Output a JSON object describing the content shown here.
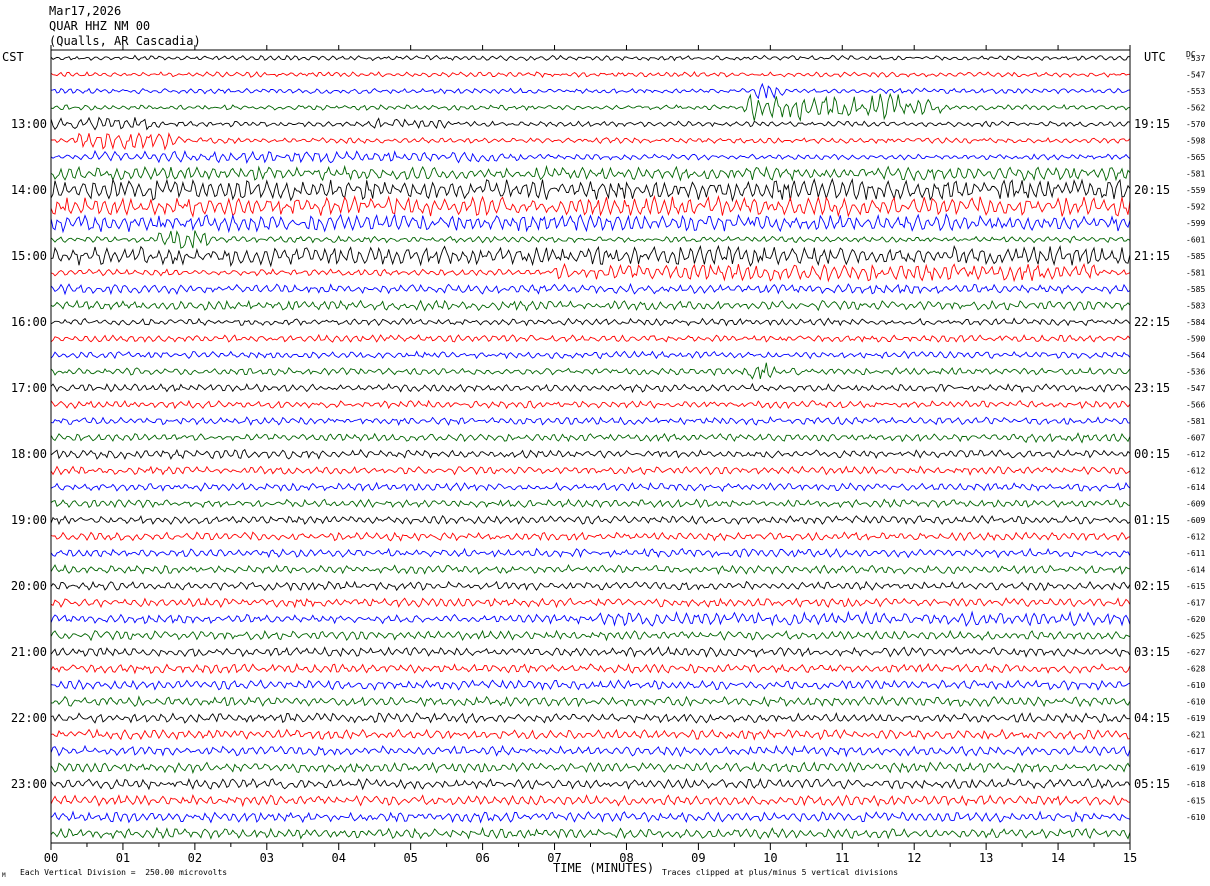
{
  "header": {
    "date": "Mar17,2026",
    "station": "QUAR HHZ NM 00",
    "location": "(Qualls, AR Cascadia)"
  },
  "left_zone": "CST",
  "right_zone": "UTC",
  "dc_label": "DC",
  "footer": {
    "scale_note": "Each Vertical Division =  250.00 microvolts",
    "clip_note": "Traces clipped at plus/minus 5 vertical divisions",
    "corner_mark": "M"
  },
  "chart_data": {
    "type": "line",
    "title": "QUAR HHZ NM 00",
    "xlabel": "TIME (MINUTES)",
    "ylabel": "",
    "xlim": [
      0,
      15
    ],
    "x_ticks": [
      "00",
      "01",
      "02",
      "03",
      "04",
      "05",
      "06",
      "07",
      "08",
      "09",
      "10",
      "11",
      "12",
      "13",
      "14",
      "15"
    ],
    "left_hour_labels": [
      "13:00",
      "14:00",
      "15:00",
      "16:00",
      "17:00",
      "18:00",
      "19:00",
      "20:00",
      "21:00",
      "22:00",
      "23:00"
    ],
    "right_hour_labels": [
      "19:15",
      "20:15",
      "21:15",
      "22:15",
      "23:15",
      "00:15",
      "01:15",
      "02:15",
      "03:15",
      "04:15",
      "05:15"
    ],
    "trace_count": 48,
    "minutes_per_trace": 15,
    "trace_colors": [
      "#000000",
      "#ff0000",
      "#0000ff",
      "#006400"
    ],
    "dc_offsets": [
      "-537",
      "-547",
      "-553",
      "-562",
      "-570",
      "-598",
      "-565",
      "-581",
      "-559",
      "-592",
      "-599",
      "-601",
      "-585",
      "-581",
      "-585",
      "-583",
      "-584",
      "-590",
      "-564",
      "-536",
      "-547",
      "-566",
      "-581",
      "-607",
      "-612",
      "-612",
      "-614",
      "-609",
      "-609",
      "-612",
      "-611",
      "-614",
      "-615",
      "-617",
      "-620",
      "-625",
      "-627",
      "-628",
      "-610",
      "-610",
      "-619",
      "-621",
      "-617",
      "-619",
      "-618",
      "-615",
      "-610"
    ],
    "scale_microvolts_per_division": 250.0,
    "clip_divisions": 5
  }
}
